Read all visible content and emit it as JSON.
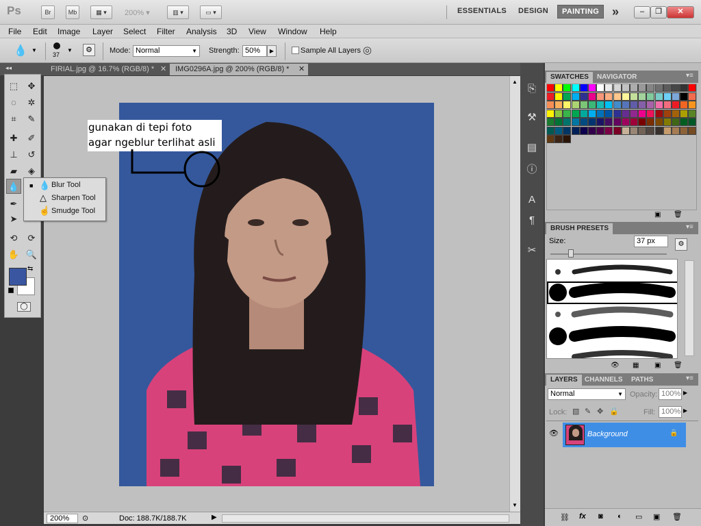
{
  "app": {
    "logo": "Ps",
    "bridge_label": "Br",
    "minibridge_label": "Mb",
    "zoom_level": "200%",
    "workspaces": [
      "ESSENTIALS",
      "DESIGN",
      "PAINTING"
    ],
    "active_workspace": "PAINTING",
    "more_workspaces": "»"
  },
  "menu": [
    "File",
    "Edit",
    "Image",
    "Layer",
    "Select",
    "Filter",
    "Analysis",
    "3D",
    "View",
    "Window",
    "Help"
  ],
  "options": {
    "brush_size": "37",
    "mode_label": "Mode:",
    "mode_value": "Normal",
    "strength_label": "Strength:",
    "strength_value": "50%",
    "sample_all_layers": "Sample All Layers"
  },
  "documents": [
    {
      "title": "FIRIAL.jpg @ 16.7% (RGB/8) *",
      "active": false
    },
    {
      "title": "IMG0296A.jpg @ 200% (RGB/8) *",
      "active": true
    }
  ],
  "tool_flyout": [
    {
      "label": "Blur Tool",
      "selected": true
    },
    {
      "label": "Sharpen Tool",
      "selected": false
    },
    {
      "label": "Smudge Tool",
      "selected": false
    }
  ],
  "colors": {
    "foreground": "#3a56a0",
    "background": "#ffffff",
    "photo_background": "#35589c",
    "layer_selected": "#3f8ee6"
  },
  "annotation": {
    "line1": "gunakan di tepi foto",
    "line2": "agar ngeblur terlihat asli"
  },
  "status": {
    "zoom": "200%",
    "doc_info": "Doc: 188.7K/188.7K"
  },
  "panels": {
    "swatches_tab": "SWATCHES",
    "navigator_tab": "NAVIGATOR",
    "brush_presets_tab": "BRUSH PRESETS",
    "size_label": "Size:",
    "size_value": "37 px",
    "layers_tab": "LAYERS",
    "channels_tab": "CHANNELS",
    "paths_tab": "PATHS",
    "blend_mode": "Normal",
    "opacity_label": "Opacity:",
    "opacity_value": "100%",
    "lock_label": "Lock:",
    "fill_label": "Fill:",
    "fill_value": "100%",
    "layer_name": "Background"
  }
}
